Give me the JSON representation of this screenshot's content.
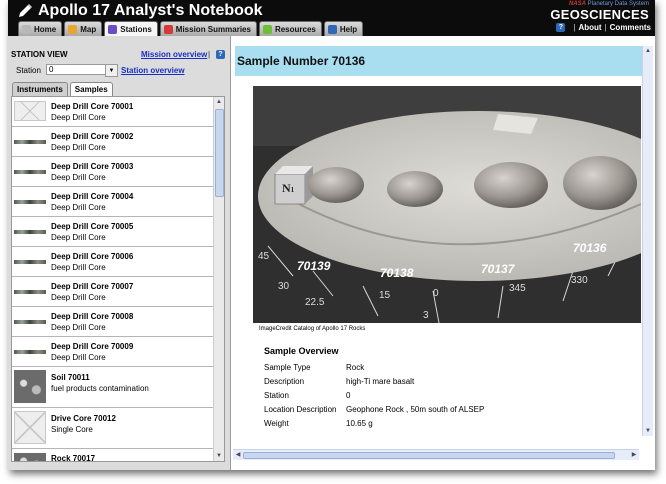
{
  "app": {
    "title": "Apollo 17 Analyst's Notebook",
    "brand_top_prefix": "NASA",
    "brand_top": "Planetary Data System",
    "brand": "GEOSCIENCES",
    "links": [
      "About",
      "Comments"
    ],
    "help_glyph": "?"
  },
  "tabs": [
    {
      "label": "Home",
      "icon": "home-icon",
      "color": "#b8b8b8"
    },
    {
      "label": "Map",
      "icon": "map-icon",
      "color": "#e8a531"
    },
    {
      "label": "Stations",
      "icon": "stations-icon",
      "color": "#6a4dc6"
    },
    {
      "label": "Mission Summaries",
      "icon": "mission-summaries-icon",
      "color": "#d43a3a"
    },
    {
      "label": "Resources",
      "icon": "resources-icon",
      "color": "#6cbf37"
    },
    {
      "label": "Help",
      "icon": "help-icon",
      "color": "#2e67b8"
    }
  ],
  "active_tab": "Stations",
  "left": {
    "title": "STATION VIEW",
    "mission_overview": "Mission overview",
    "separator": "|",
    "station_label": "Station",
    "station_value": "0",
    "station_overview": "Station overview",
    "subtabs": [
      "Instruments",
      "Samples"
    ],
    "active_subtab": "Samples",
    "items": [
      {
        "title": "Deep Drill Core 70001",
        "sub": "Deep Drill Core",
        "thumb": "empty"
      },
      {
        "title": "Deep Drill Core 70002",
        "sub": "Deep Drill Core",
        "thumb": "core"
      },
      {
        "title": "Deep Drill Core 70003",
        "sub": "Deep Drill Core",
        "thumb": "core"
      },
      {
        "title": "Deep Drill Core 70004",
        "sub": "Deep Drill Core",
        "thumb": "core"
      },
      {
        "title": "Deep Drill Core 70005",
        "sub": "Deep Drill Core",
        "thumb": "core"
      },
      {
        "title": "Deep Drill Core 70006",
        "sub": "Deep Drill Core",
        "thumb": "core"
      },
      {
        "title": "Deep Drill Core 70007",
        "sub": "Deep Drill Core",
        "thumb": "core"
      },
      {
        "title": "Deep Drill Core 70008",
        "sub": "Deep Drill Core",
        "thumb": "core"
      },
      {
        "title": "Deep Drill Core 70009",
        "sub": "Deep Drill Core",
        "thumb": "core"
      },
      {
        "title": "Soil 70011",
        "sub": "fuel products contamination",
        "thumb": "soil"
      },
      {
        "title": "Drive Core 70012",
        "sub": "Single Core",
        "thumb": "empty"
      },
      {
        "title": "Rock 70017",
        "sub": "",
        "thumb": "soil"
      }
    ]
  },
  "right": {
    "sample_title": "Sample Number 70136",
    "photo_labels": [
      "70139",
      "70138",
      "70137",
      "70136"
    ],
    "photo_cube": "N",
    "photo_cube_sub": "1",
    "photo_scale": [
      "45",
      "30",
      "22.5",
      "15",
      "0",
      "345",
      "330",
      "3"
    ],
    "credit": "ImageCredit  Catalog of Apollo 17 Rocks",
    "overview_title": "Sample Overview",
    "overview": [
      {
        "key": "Sample Type",
        "value": "Rock"
      },
      {
        "key": "Description",
        "value": "high-Ti mare basalt"
      },
      {
        "key": "Station",
        "value": "0"
      },
      {
        "key": "Location Description",
        "value": "Geophone Rock , 50m south of ALSEP"
      },
      {
        "key": "Weight",
        "value": "10.65 g"
      }
    ]
  }
}
